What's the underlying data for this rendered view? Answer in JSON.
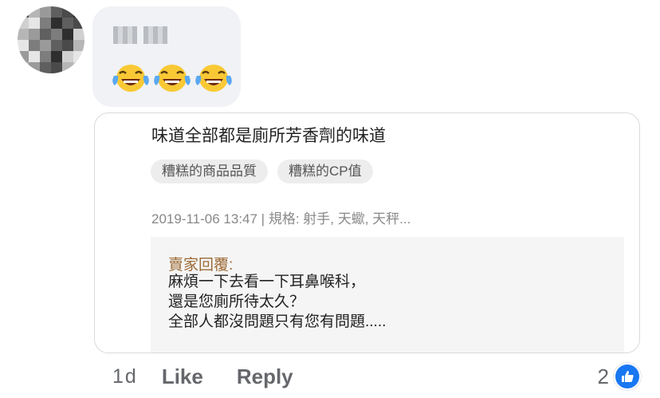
{
  "comment": {
    "reactions": [
      "face-with-tears-of-joy",
      "face-with-tears-of-joy",
      "face-with-tears-of-joy"
    ],
    "time": "1d",
    "like_label": "Like",
    "reply_label": "Reply",
    "reaction_count": "2",
    "reaction_icon": "like-thumb-icon"
  },
  "review": {
    "text": "味道全部都是廁所芳香劑的味道",
    "tags": [
      "糟糕的商品品質",
      "糟糕的CP值"
    ],
    "meta": "2019-11-06 13:47 | 規格: 射手, 天蠍, 天秤...",
    "seller_reply": {
      "title": "賣家回覆:",
      "lines": [
        "麻煩一下去看一下耳鼻喉科，",
        "還是您廁所待太久？",
        "全部人都沒問題只有您有問題....."
      ]
    }
  },
  "colors": {
    "accent": "#1877f2",
    "seller_title": "#9c6a35",
    "muted": "#65676b"
  }
}
